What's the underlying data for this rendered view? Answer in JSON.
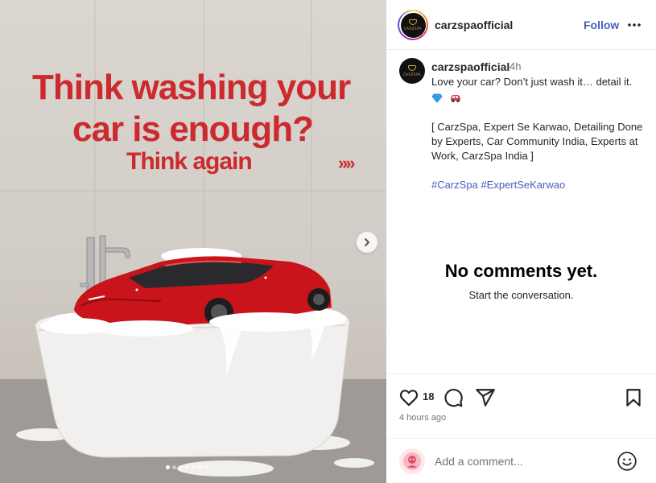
{
  "post": {
    "headline": {
      "line1": "Think washing your",
      "line2": "car is enough?",
      "line3": "Think again",
      "arrows": "»»"
    },
    "carousel": {
      "slide_count": 7,
      "active_index": 0
    }
  },
  "header": {
    "username": "carzspaofficial",
    "follow_label": "Follow"
  },
  "caption": {
    "username": "carzspaofficial",
    "time": "4h",
    "text_line": "Love your car? Don’t just wash it… detail it.",
    "emojis": [
      "💎",
      "🚙"
    ],
    "tags_text": "[ CarzSpa, Expert Se Karwao, Detailing Done by Experts, Car Community India, Experts at Work, CarzSpa India ]",
    "hashtags": [
      "#CarzSpa",
      "#ExpertSeKarwao"
    ]
  },
  "comments": {
    "empty_title": "No comments yet.",
    "empty_subtitle": "Start the conversation."
  },
  "actions": {
    "like_count": "18",
    "time_ago": "4 hours ago"
  },
  "comment_box": {
    "placeholder": "Add a comment..."
  },
  "colors": {
    "accent_link": "#4a5db8",
    "headline_red": "#cc2a2e",
    "car_red": "#c8141a"
  },
  "icons": [
    "heart-icon",
    "comment-icon",
    "share-icon",
    "bookmark-icon",
    "more-icon",
    "emoji-icon",
    "chevron-right-icon"
  ]
}
